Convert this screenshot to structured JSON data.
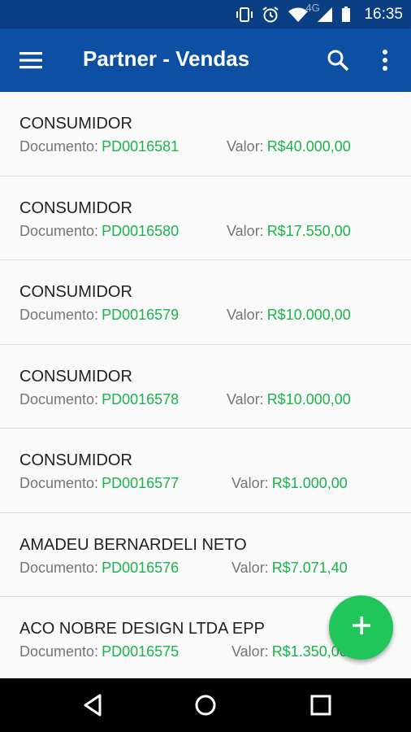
{
  "status_bar": {
    "time": "16:35",
    "network": "4G",
    "icons": [
      "vibrate-icon",
      "alarm-icon",
      "wifi-icon",
      "signal-icon",
      "battery-icon"
    ]
  },
  "app_bar": {
    "title": "Partner - Vendas",
    "icons": [
      "menu-icon",
      "search-icon",
      "more-vert-icon"
    ]
  },
  "labels": {
    "documento": "Documento:",
    "valor": "Valor:"
  },
  "sales": [
    {
      "name": "CONSUMIDOR",
      "documento": "PD0016581",
      "valor": "R$40.000,00"
    },
    {
      "name": "CONSUMIDOR",
      "documento": "PD0016580",
      "valor": "R$17.550,00"
    },
    {
      "name": "CONSUMIDOR",
      "documento": "PD0016579",
      "valor": "R$10.000,00"
    },
    {
      "name": "CONSUMIDOR",
      "documento": "PD0016578",
      "valor": "R$10.000,00"
    },
    {
      "name": "CONSUMIDOR",
      "documento": "PD0016577",
      "valor": "R$1.000,00"
    },
    {
      "name": "AMADEU BERNARDELI NETO",
      "documento": "PD0016576",
      "valor": "R$7.071,40"
    },
    {
      "name": "ACO NOBRE DESIGN LTDA EPP",
      "documento": "PD0016575",
      "valor": "R$1.350,00"
    }
  ],
  "fab": {
    "icon": "add-icon"
  },
  "nav_bar": {
    "icons": [
      "back-icon",
      "home-icon",
      "recents-icon"
    ]
  },
  "colors": {
    "status_bar": "#0a3f83",
    "app_bar": "#0d4fa3",
    "accent_green": "#1bb34b",
    "fab": "#20c659"
  }
}
